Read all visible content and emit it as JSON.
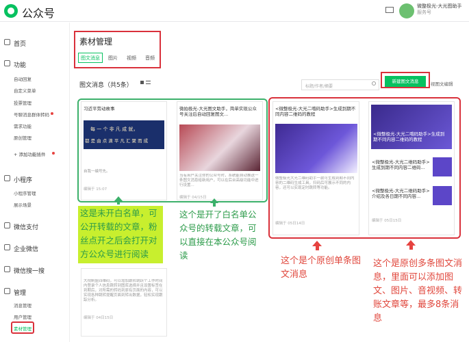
{
  "app": {
    "name": "公众号",
    "account_name": "微整极光-大光图助手",
    "account_sub": "服务号"
  },
  "sidebar": {
    "home": "首页",
    "func_header": "功能",
    "func_items": [
      "自动回复",
      "自定义菜单",
      "投票管理",
      "号聊消息群体转码",
      "需求功能",
      "原创管理"
    ],
    "add_plugin": "+ 添加功能插件",
    "mini_header": "小程序",
    "mini_items": [
      "小程序管理",
      "展示场景"
    ],
    "pay": "微信支付",
    "wework": "企业微信",
    "search": "微信搜一搜",
    "manage_header": "管理",
    "manage_items": [
      "消息管理",
      "用户管理",
      "素材管理"
    ]
  },
  "header": {
    "title": "素材管理",
    "tabs": [
      "图文消息",
      "图片",
      "视频",
      "音频"
    ],
    "sub_title": "图文消息（共5条）",
    "search_placeholder": "标题/作者/摘要",
    "new_button": "新建图文消息",
    "guide": "视图文编辑"
  },
  "cards": {
    "c1": {
      "title": "习近平劳动故事",
      "banner1": "每 一 个 非 凡 成 就，",
      "banner2": "都 是 由 点 滴 平 凡 汇 聚 而 成",
      "summary": "自我一编号先。",
      "footer": "编辑于 15:07"
    },
    "c2": {
      "title": "微拍极光-大光图文助手，简单实现公众号关注后自动回复图文...",
      "body": "当有用户关注你的公众号时，系统能自动推送一条图文消息给新用户，可以在后台高级功能中进行设置...",
      "footer": "编辑于 04/15日"
    },
    "c3": {
      "title": "<微整极光-大光二哦码助手>生成到期不同内容二维码的教程",
      "body": "微整极光大光二维码助手一款可生成到期不同内容的二维码生成工具，扫码后可展示不同的内容，还可以实现定时跳转等功能。",
      "footer": "编辑于 05日14日"
    },
    "c4": {
      "banner_title": "<微整极光-大光二哦码助手>生成到期不同内容二维码的教程",
      "items": [
        "<微整极光-大光二维码助手>生成到期不同内容二维码...",
        "<微整极光-大光二维码助手>介绍及各日期不同内容..."
      ],
      "footer": "编辑于 05日15日"
    },
    "c5": {
      "body": "大视制盛四维码，可以增加跟转跳跃个工作时间内登录个人信息跳转到图库选择并且设置标签在到期后，对所需的转码到原有页面的内容，可以实现各种跳转提醒页面到转出数据，轻松实现跟踪分析。",
      "footer": "编辑于 04日15日"
    }
  },
  "annotations": {
    "green1": "这是未开白名单，可公开转载的文章，粉丝点开之后会打开对方公众号进行阅读",
    "green2": "这个是开了白名单公众号的转载文章，可以直接在本公众号阅读",
    "red1": "这个是个原创单条图文消息",
    "red2": "这个是原创多条图文消息，里面可以添加图文、图片、音视频、转账文章等，最多8条消息"
  },
  "colors": {
    "brand": "#07c160",
    "annotation_green": "#2c9b4a",
    "annotation_red": "#e0463b",
    "highlight_yellow": "#c8ef2e"
  }
}
